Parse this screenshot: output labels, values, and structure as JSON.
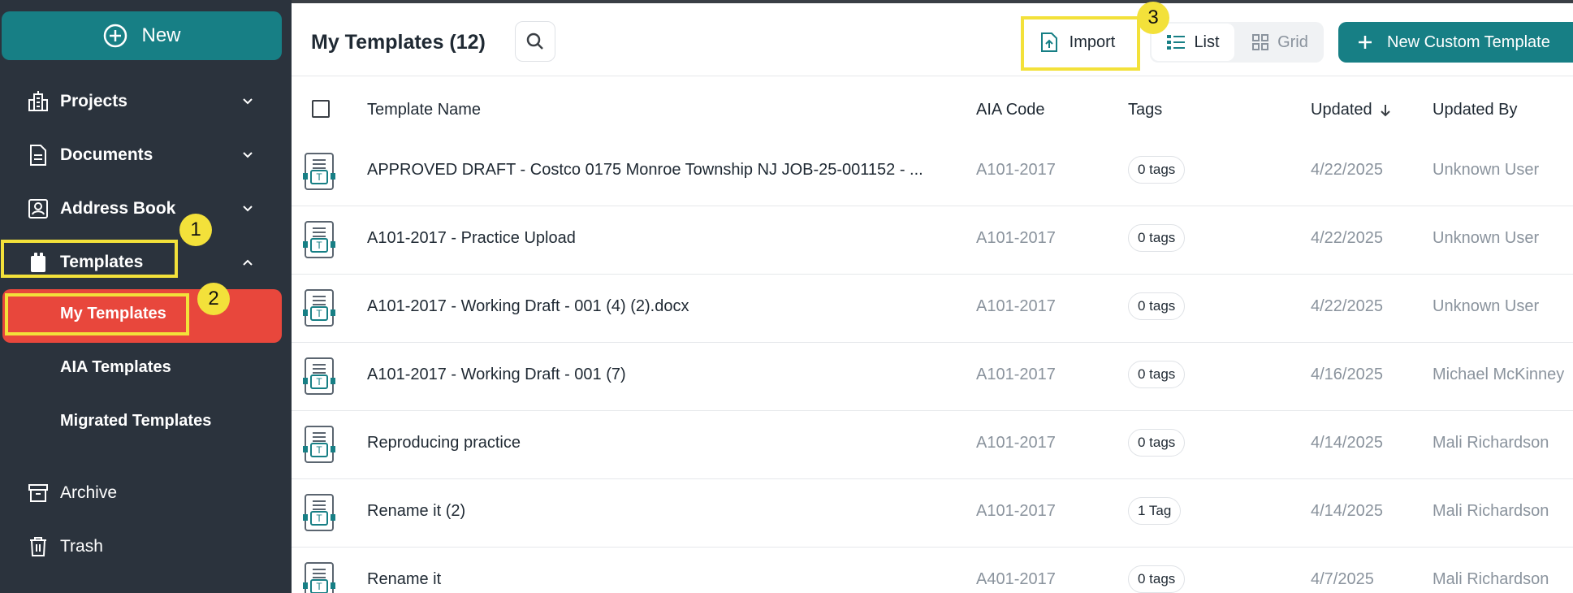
{
  "sidebar": {
    "new_label": "New",
    "items": [
      {
        "label": "Projects",
        "icon": "building-icon",
        "expanded": false
      },
      {
        "label": "Documents",
        "icon": "document-icon",
        "expanded": false
      },
      {
        "label": "Address Book",
        "icon": "contact-card-icon",
        "expanded": false
      },
      {
        "label": "Templates",
        "icon": "template-folder-icon",
        "expanded": true
      },
      {
        "label": "Archive",
        "icon": "archive-box-icon"
      },
      {
        "label": "Trash",
        "icon": "trash-icon"
      }
    ],
    "template_subitems": [
      {
        "label": "My Templates",
        "active": true
      },
      {
        "label": "AIA Templates",
        "active": false
      },
      {
        "label": "Migrated Templates",
        "active": false
      }
    ]
  },
  "annotations": {
    "badge1": "1",
    "badge2": "2",
    "badge3": "3",
    "highlight_color": "#f3e13a"
  },
  "header": {
    "title": "My Templates (12)",
    "import_label": "Import",
    "view_list_label": "List",
    "view_grid_label": "Grid",
    "active_view": "List",
    "new_custom_label": "New Custom Template"
  },
  "table": {
    "columns": [
      "Template Name",
      "AIA Code",
      "Tags",
      "Updated",
      "Updated By"
    ],
    "sort": {
      "column": "Updated",
      "direction": "desc"
    },
    "rows": [
      {
        "name": "APPROVED DRAFT - Costco 0175 Monroe Township NJ JOB-25-001152 - ...",
        "aia": "A101-2017",
        "tags": "0 tags",
        "updated": "4/22/2025",
        "by": "Unknown User"
      },
      {
        "name": "A101-2017 - Practice Upload",
        "aia": "A101-2017",
        "tags": "0 tags",
        "updated": "4/22/2025",
        "by": "Unknown User"
      },
      {
        "name": "A101-2017 - Working Draft - 001 (4) (2).docx",
        "aia": "A101-2017",
        "tags": "0 tags",
        "updated": "4/22/2025",
        "by": "Unknown User"
      },
      {
        "name": "A101-2017 - Working Draft - 001 (7)",
        "aia": "A101-2017",
        "tags": "0 tags",
        "updated": "4/16/2025",
        "by": "Michael McKinney"
      },
      {
        "name": "Reproducing practice",
        "aia": "A101-2017",
        "tags": "0 tags",
        "updated": "4/14/2025",
        "by": "Mali Richardson"
      },
      {
        "name": "Rename it (2)",
        "aia": "A101-2017",
        "tags": "1 Tag",
        "updated": "4/14/2025",
        "by": "Mali Richardson"
      },
      {
        "name": "Rename it",
        "aia": "A401-2017",
        "tags": "0 tags",
        "updated": "4/7/2025",
        "by": "Mali Richardson"
      }
    ]
  },
  "colors": {
    "sidebar_bg": "#2b333d",
    "accent": "#177f85",
    "active_item": "#e8473c",
    "muted_text": "#8a939d"
  }
}
